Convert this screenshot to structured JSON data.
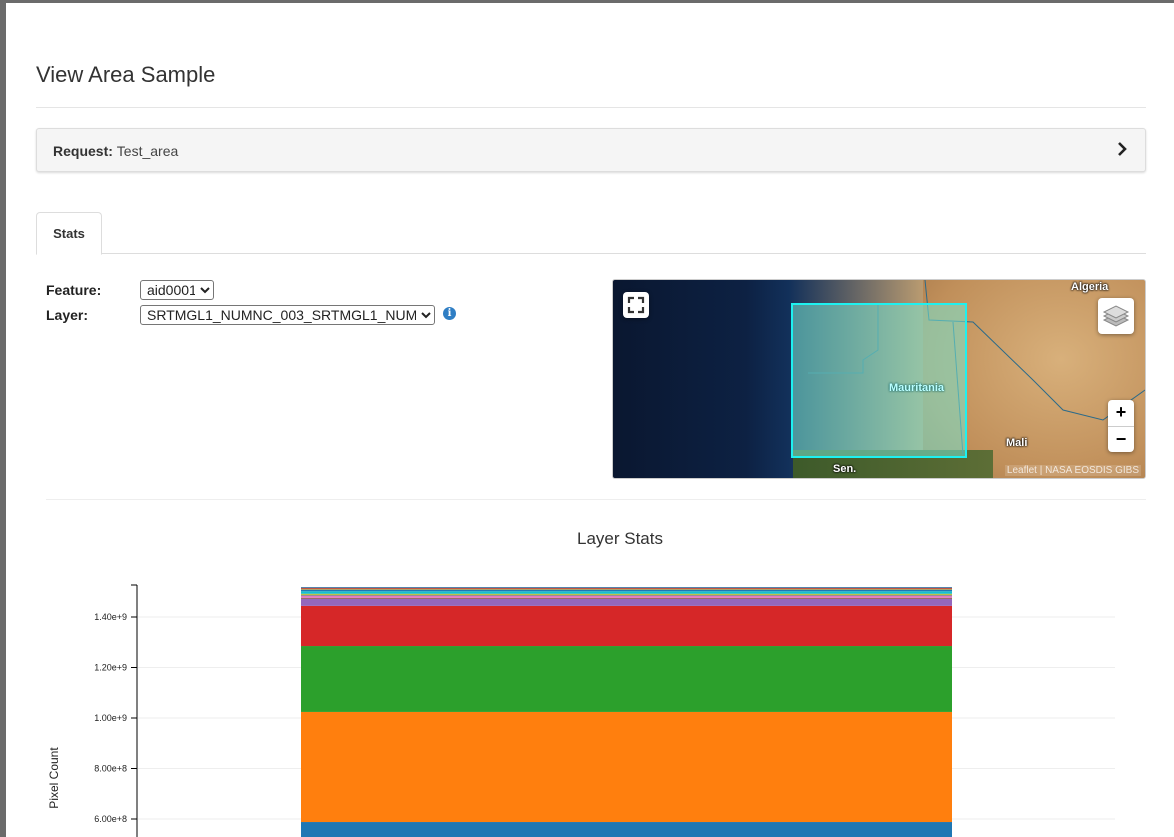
{
  "page": {
    "title": "View Area Sample"
  },
  "request": {
    "label": "Request:",
    "value": "Test_area"
  },
  "tabs": [
    {
      "label": "Stats"
    }
  ],
  "form": {
    "feature": {
      "label": "Feature:",
      "value": "aid0001"
    },
    "layer": {
      "label": "Layer:",
      "value": "SRTMGL1_NUMNC_003_SRTMGL1_NUM"
    },
    "info_icon": "info-circle-icon"
  },
  "map": {
    "labels": [
      "Mauritania",
      "Mali",
      "Sen.",
      "Algeria"
    ],
    "zoom_in": "+",
    "zoom_out": "−",
    "attribution": "Leaflet | NASA EOSDIS GIBS",
    "aoi_color": "#1ef1f0",
    "icons": [
      "fullscreen-icon",
      "layers-icon"
    ]
  },
  "chart_data": {
    "type": "bar",
    "stacked": true,
    "title": "Layer Stats",
    "ylabel": "Pixel Count",
    "yticks": [
      "6.00e+8",
      "8.00e+8",
      "1.00e+9",
      "1.20e+9",
      "1.40e+9"
    ],
    "ytick_values": [
      600000000,
      800000000,
      1000000000,
      1200000000,
      1400000000
    ],
    "ylim": [
      0,
      1527000000
    ],
    "grid": true,
    "segments": [
      {
        "value": 588000000,
        "color": "#1f77b4"
      },
      {
        "value": 436000000,
        "color": "#ff7f0e"
      },
      {
        "value": 261000000,
        "color": "#2ca02c"
      },
      {
        "value": 159000000,
        "color": "#d62728"
      },
      {
        "value": 28000000,
        "color": "#9467bd"
      },
      {
        "value": 4000000,
        "color": "#8c564b"
      },
      {
        "value": 8000000,
        "color": "#e377c2"
      },
      {
        "value": 4000000,
        "color": "#7f7f7f"
      },
      {
        "value": 4000000,
        "color": "#bcbd22"
      },
      {
        "value": 10000000,
        "color": "#17becf"
      },
      {
        "value": 6000000,
        "color": "#1f77b4"
      },
      {
        "value": 2000000,
        "color": "#ff7f0e"
      },
      {
        "value": 2000000,
        "color": "#2ca02c"
      },
      {
        "value": 3000000,
        "color": "#d62728"
      },
      {
        "value": 3000000,
        "color": "#1f5f94"
      }
    ]
  }
}
